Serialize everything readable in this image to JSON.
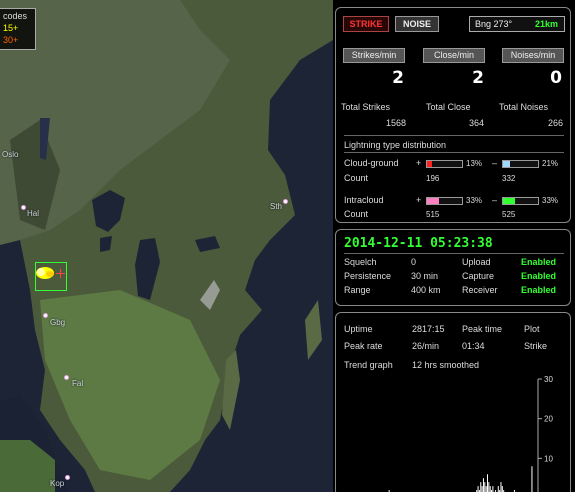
{
  "map": {
    "legend": {
      "line1": "codes",
      "line2": "15+",
      "line3": "30+"
    },
    "cities": [
      "Oslo",
      "Hal",
      "Gbg",
      "Fal",
      "Kop",
      "Sth"
    ]
  },
  "status_bar": {
    "strike_button": "STRIKE",
    "noise_button": "NOISE",
    "bearing": "Bng 273°",
    "distance": "21km"
  },
  "rates": {
    "strikes_label": "Strikes/min",
    "close_label": "Close/min",
    "noises_label": "Noises/min",
    "strikes_value": "2",
    "close_value": "2",
    "noises_value": "0"
  },
  "totals": {
    "strikes_label": "Total Strikes",
    "close_label": "Total Close",
    "noises_label": "Total Noises",
    "strikes_value": "1568",
    "close_value": "364",
    "noises_value": "266"
  },
  "distribution": {
    "title": "Lightning type distribution",
    "cg_label": "Cloud-ground",
    "ic_label": "Intracloud",
    "count_label": "Count",
    "plus": "+",
    "minus": "–",
    "cg_pos_pct": "13%",
    "cg_neg_pct": "21%",
    "ic_pos_pct": "33%",
    "ic_neg_pct": "33%",
    "cg_pos_count": "196",
    "cg_neg_count": "332",
    "ic_pos_count": "515",
    "ic_neg_count": "525",
    "cg_pos_frac": 0.13,
    "cg_neg_frac": 0.21,
    "ic_pos_frac": 0.33,
    "ic_neg_frac": 0.33,
    "colors": {
      "cg_pos": "#ff2020",
      "cg_neg": "#a0d8ff",
      "ic_pos": "#ff80c0",
      "ic_neg": "#30ff30"
    }
  },
  "settings": {
    "datetime": "2014-12-11 05:23:38",
    "squelch_label": "Squelch",
    "squelch_value": "0",
    "persistence_label": "Persistence",
    "persistence_value": "30 min",
    "range_label": "Range",
    "range_value": "400 km",
    "upload_label": "Upload",
    "upload_value": "Enabled",
    "capture_label": "Capture",
    "capture_value": "Enabled",
    "receiver_label": "Receiver",
    "receiver_value": "Enabled"
  },
  "stats": {
    "uptime_label": "Uptime",
    "uptime_value": "2817:15",
    "peak_time_label": "Peak time",
    "peak_time_value": "01:34",
    "plot_label": "Plot",
    "plot_value": "Strike",
    "peak_rate_label": "Peak rate",
    "peak_rate_value": "26/min",
    "trend_label": "Trend graph",
    "trend_value": "12 hrs smoothed"
  },
  "chart_data": {
    "type": "bar",
    "title": "",
    "ylim": [
      0,
      30
    ],
    "y_ticks": [
      "30",
      "20",
      "10"
    ],
    "values": [
      0,
      0,
      0,
      0,
      0,
      0,
      0,
      0,
      0,
      0,
      0,
      0,
      0,
      0,
      0,
      0,
      0,
      0,
      0,
      0,
      0,
      0,
      0,
      0,
      0,
      0,
      0,
      0,
      0,
      0,
      0,
      0,
      0,
      0,
      0,
      2,
      0,
      0,
      0,
      0,
      0,
      0,
      0,
      1,
      0,
      0,
      0,
      0,
      0,
      0,
      0,
      0,
      0,
      0,
      0,
      0,
      0,
      1,
      0,
      0,
      0,
      0,
      0,
      0,
      0,
      0,
      0,
      0,
      0,
      0,
      1,
      0,
      0,
      0,
      0,
      0,
      0,
      0,
      0,
      0,
      0,
      1,
      0,
      0,
      0,
      0,
      0,
      0,
      0,
      0,
      1,
      0,
      0,
      1,
      0,
      0,
      0,
      0,
      0,
      1,
      2,
      3,
      2,
      4,
      3,
      5,
      4,
      3,
      6,
      4,
      3,
      2,
      3,
      1,
      2,
      1,
      3,
      2,
      4,
      3,
      2,
      1,
      0,
      0,
      0,
      0,
      0,
      0,
      2,
      0,
      0,
      0,
      0,
      0,
      0,
      0,
      0,
      0,
      0,
      0,
      0,
      8,
      0,
      0,
      0
    ]
  }
}
